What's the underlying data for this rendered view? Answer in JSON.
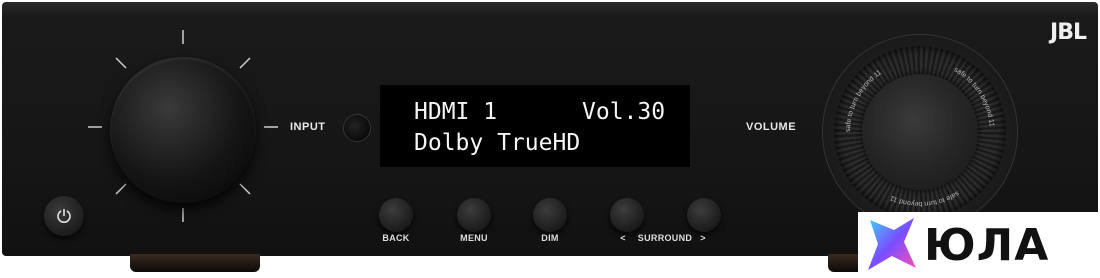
{
  "device": {
    "brand": "JBL",
    "input_label": "INPUT",
    "volume_label": "VOLUME",
    "display": {
      "line1_left": "HDMI 1",
      "line1_right": "Vol.30",
      "line2": "Dolby TrueHD"
    },
    "volume_ring_text": "safe to turn beyond 11",
    "buttons": [
      {
        "label": "BACK"
      },
      {
        "label": "MENU"
      },
      {
        "label": "DIM"
      },
      {
        "label": "SURROUND"
      },
      {
        "label": ""
      }
    ],
    "surround_prev": "<",
    "surround_next": ">"
  },
  "watermark": {
    "text": "ЮЛА",
    "colors": [
      "#3fd2ff",
      "#7a4dff",
      "#ff4fb3"
    ]
  },
  "icons": {
    "power": "power-icon"
  }
}
